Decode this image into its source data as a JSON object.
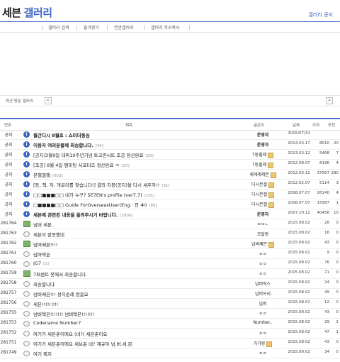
{
  "header": {
    "gallery_name_a": "세븐",
    "gallery_name_b": "갤러리",
    "notice_link": "갤러리 공지"
  },
  "tabs": [
    "갤러리 검색",
    "즐겨찾기",
    "연관갤러리",
    "갤러리 주소복사"
  ],
  "recent": {
    "label": "최근 방문 갤러리",
    "prev": "<",
    "next": ">"
  },
  "table_header": {
    "no": "번호",
    "title": "제목",
    "author": "글쓴이",
    "date": "날짜",
    "views": "조회",
    "recommend": "추천"
  },
  "rows": [
    {
      "no": "공지",
      "icon": "info",
      "title": "월간디시 8월호 : 쇼미더동심",
      "count": "",
      "author": "운영자",
      "author_bold": true,
      "badge": false,
      "date": "2015/07/31",
      "views": "",
      "rec": "",
      "bold": true
    },
    {
      "no": "공지",
      "icon": "info",
      "title": "이용자 여러분들께 죄송합니다.",
      "count": "[44]",
      "author": "운영자",
      "author_bold": true,
      "badge": false,
      "date": "2014.03.17",
      "views": "8010",
      "rec": "20",
      "bold": true
    },
    {
      "no": "공지",
      "icon": "info",
      "title": "[공지]3월9일 데뷔10주년기념 토크콘서트 조공 정산완료",
      "count": "[20]",
      "author": "7동힐래",
      "author_bold": false,
      "badge": true,
      "date": "2013.03.12",
      "views": "5468",
      "rec": "7",
      "bold": false
    },
    {
      "no": "공지",
      "icon": "info",
      "title": "[조공] 8월 4일 팬미팅 서포터즈 정산완료 ㅋ",
      "count": "[37]",
      "author": "7동힐래",
      "author_bold": false,
      "badge": true,
      "date": "2012.08.07",
      "views": "6196",
      "rec": "4",
      "bold": false
    },
    {
      "no": "공지",
      "icon": "info",
      "title": "븐챌갤챌",
      "count": "[653]",
      "author": "세레레레븐",
      "author_bold": false,
      "badge": true,
      "date": "2012.03.11",
      "views": "37567",
      "rec": "280",
      "bold": false
    },
    {
      "no": "공지",
      "icon": "info",
      "title": "[등, 책, 자. 개로리를 찾습니다!] 결의 지붕(공지)을 다시 세우자!!",
      "count": "[31]",
      "author": "디시븐갤",
      "author_bold": false,
      "badge": true,
      "date": "2012.02.07",
      "views": "5114",
      "rec": "3",
      "bold": false
    },
    {
      "no": "공지",
      "icon": "info",
      "title": "□□■■■□□ 내가 누구? SE7EN's profile (ver7.7)",
      "count": "[101]",
      "author": "디시븐갤",
      "author_bold": false,
      "badge": true,
      "date": "2008.07.07",
      "views": "26140",
      "rec": "4",
      "bold": false
    },
    {
      "no": "공지",
      "icon": "info",
      "title": "□■■■■□□ Guide ForOverseasUser(Eng.· 日 中)",
      "count": "[89]",
      "author": "디시븐갤",
      "author_bold": false,
      "badge": true,
      "date": "2008.07.07",
      "views": "15587",
      "rec": "1",
      "bold": false
    },
    {
      "no": "공지",
      "icon": "info",
      "title": "세븐에 관련된 내용을 올려주시기 바랍니다.",
      "count": "[2006]",
      "author": "운영자",
      "author_bold": true,
      "badge": false,
      "date": "2007.10.12",
      "views": "40458",
      "rec": "10",
      "bold": true
    },
    {
      "no": "281764",
      "icon": "img",
      "title": "넘버 세븐..",
      "count": "",
      "author": "ㅇㅁㄴ",
      "author_bold": false,
      "badge": false,
      "date": "2015.08.02",
      "views": "28",
      "rec": "0",
      "bold": false
    },
    {
      "no": "281763",
      "icon": "bub",
      "title": "세븐이 잘못했네",
      "count": "",
      "author": "코알랑",
      "author_bold": false,
      "badge": false,
      "date": "2015.08.02",
      "views": "16",
      "rec": "0",
      "bold": false
    },
    {
      "no": "281762",
      "icon": "img",
      "title": "넘버쎄븐!!!!",
      "count": "",
      "author": "넘버쎄븐",
      "author_bold": false,
      "badge": true,
      "date": "2015.08.02",
      "views": "43",
      "rec": "0",
      "bold": false
    },
    {
      "no": "281761",
      "icon": "bub",
      "title": "넘버텍븐",
      "count": "",
      "author": "ㅇㅇ",
      "author_bold": false,
      "badge": false,
      "date": "2015.08.02",
      "views": "9",
      "rec": "0",
      "bold": false
    },
    {
      "no": "281760",
      "icon": "bub",
      "title": "JG7",
      "count": "[1]",
      "author": "ㅇㅇ",
      "author_bold": false,
      "badge": false,
      "date": "2015.08.02",
      "views": "76",
      "rec": "0",
      "bold": false
    },
    {
      "no": "281759",
      "icon": "img",
      "title": "7퍼센트 못해서 죄송합니다.",
      "count": "",
      "author": "ㅇㅇ",
      "author_bold": false,
      "badge": false,
      "date": "2015.08.02",
      "views": "71",
      "rec": "0",
      "bold": false
    },
    {
      "no": "281758",
      "icon": "bub",
      "title": "죄송합니다",
      "count": "",
      "author": "넘버씩스",
      "author_bold": false,
      "badge": false,
      "date": "2015.08.02",
      "views": "24",
      "rec": "0",
      "bold": false
    },
    {
      "no": "281757",
      "icon": "bub",
      "title": "넘버쎄븐!!! 성지순례 왔음요",
      "count": "",
      "author": "넘버쓰리",
      "author_bold": false,
      "badge": false,
      "date": "2015.08.02",
      "views": "49",
      "rec": "0",
      "bold": false
    },
    {
      "no": "281756",
      "icon": "bub",
      "title": "세븐!!!!!!!!!",
      "count": "",
      "author": "넘버",
      "author_bold": false,
      "badge": false,
      "date": "2015.08.02",
      "views": "12",
      "rec": "0",
      "bold": false
    },
    {
      "no": "281755",
      "icon": "bub",
      "title": "넘버텍븐!!!!!!! 넘버텍븐!!!!!!!",
      "count": "",
      "author": "ㅇㅇ",
      "author_bold": false,
      "badge": false,
      "date": "2015.08.02",
      "views": "43",
      "rec": "0",
      "bold": false
    },
    {
      "no": "281753",
      "icon": "bub",
      "title": "Codename Number7",
      "count": "",
      "author": "Number..",
      "author_bold": false,
      "badge": false,
      "date": "2015.08.02",
      "views": "29",
      "rec": "2",
      "bold": false
    },
    {
      "no": "281752",
      "icon": "bub",
      "title": "여기가 세븐춘이에요 (네?) 세븐춘이요",
      "count": "",
      "author": "ㅇㅇ",
      "author_bold": false,
      "badge": false,
      "date": "2015.08.02",
      "views": "47",
      "rec": "1",
      "bold": false
    },
    {
      "no": "281751",
      "icon": "bub",
      "title": "여기가 세븐춘이에요 세브춘 네? 재규야 넘.버.세.븐.",
      "count": "",
      "author": "가가랑",
      "author_bold": false,
      "badge": true,
      "date": "2015.08.02",
      "views": "43",
      "rec": "0",
      "bold": false
    },
    {
      "no": "281749",
      "icon": "bub",
      "title": "여기 뭐지",
      "count": "",
      "author": "ㅇㅇ",
      "author_bold": false,
      "badge": false,
      "date": "2015.08.02",
      "views": "34",
      "rec": "0",
      "bold": false
    }
  ]
}
